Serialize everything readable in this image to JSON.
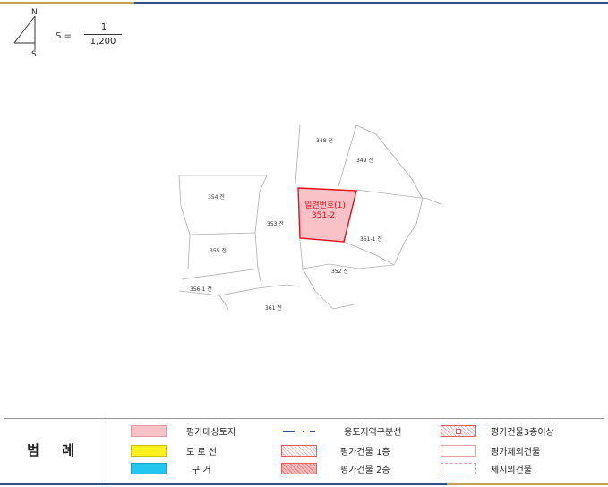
{
  "compass": {
    "north": "N",
    "south": "S"
  },
  "scale": {
    "prefix": "S =",
    "numerator": "1",
    "denominator": "1,200"
  },
  "map": {
    "parcels": [
      {
        "label": "348 전"
      },
      {
        "label": "349 전"
      },
      {
        "label": "354 전"
      },
      {
        "label": "353 전"
      },
      {
        "label": "351-1 전"
      },
      {
        "label": "355 전"
      },
      {
        "label": "352 전"
      },
      {
        "label": "356-1 전"
      },
      {
        "label": "361 전"
      }
    ],
    "subject": {
      "line1": "일련번호(1)",
      "line2": "351-2"
    },
    "colors": {
      "subject_fill": "#f8c2c6",
      "subject_border": "#e0101a",
      "subject_text": "#e0101a",
      "boundary": "#b0b0b0"
    }
  },
  "legend": {
    "title": "범 례",
    "col1": [
      {
        "icon": "pink-fill-swatch",
        "label": "평가대상토지"
      },
      {
        "icon": "yellow-fill-swatch",
        "label": "도 로 선"
      },
      {
        "icon": "cyan-fill-swatch",
        "label": "구   거"
      }
    ],
    "col2": [
      {
        "icon": "dash-dot-line",
        "label": "용도지역구분선"
      },
      {
        "icon": "light-hatch-swatch",
        "label": "평가건물 1층"
      },
      {
        "icon": "dense-hatch-swatch",
        "label": "평가건물 2층"
      }
    ],
    "col3": [
      {
        "icon": "hatch-dot-swatch",
        "label": "평가건물3층이상"
      },
      {
        "icon": "white-swatch",
        "label": "평가제외건물"
      },
      {
        "icon": "dashed-swatch",
        "label": "제시외건물"
      }
    ]
  }
}
